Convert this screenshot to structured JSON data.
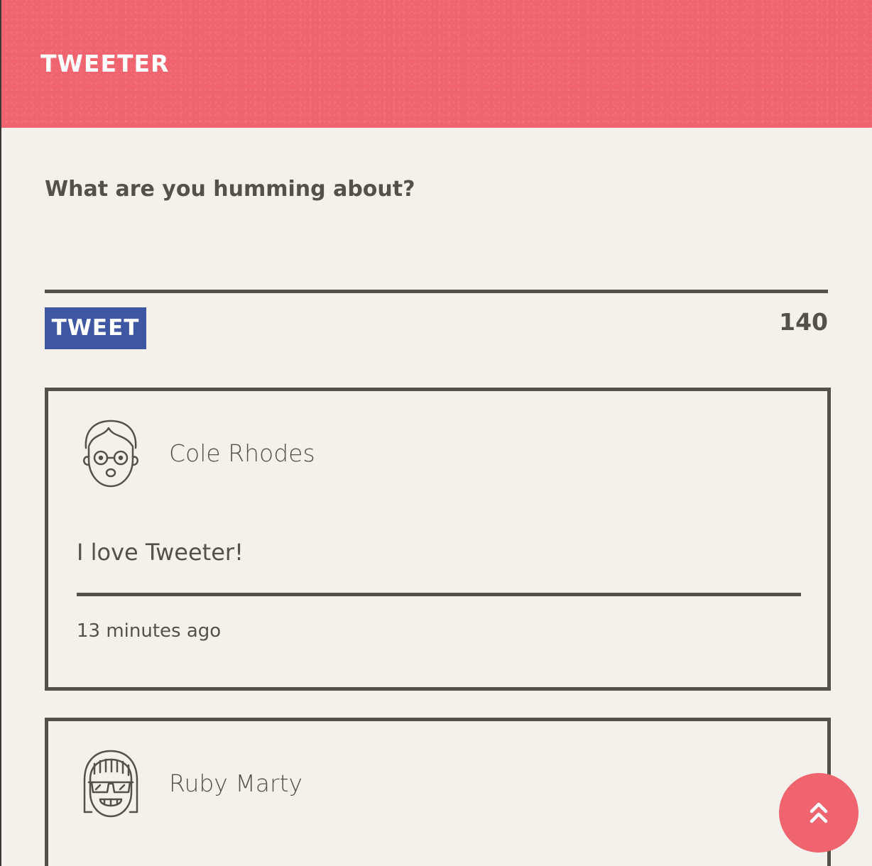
{
  "header": {
    "brand": "TWEETER",
    "background_color": "#f0646f"
  },
  "composer": {
    "prompt": "What are you humming about?",
    "input_value": "",
    "tweet_button_label": "TWEET",
    "tweet_button_color": "#3f56a3",
    "char_counter": "140"
  },
  "tweets": [
    {
      "author": "Cole Rhodes",
      "avatar_icon": "glasses-face-avatar-icon",
      "text": "I love Tweeter!",
      "timestamp": "13 minutes ago"
    },
    {
      "author": "Ruby Marty",
      "avatar_icon": "sunglasses-face-avatar-icon"
    }
  ],
  "scroll_top_button": {
    "icon": "double-chevron-up-icon",
    "color": "#f0646f"
  }
}
